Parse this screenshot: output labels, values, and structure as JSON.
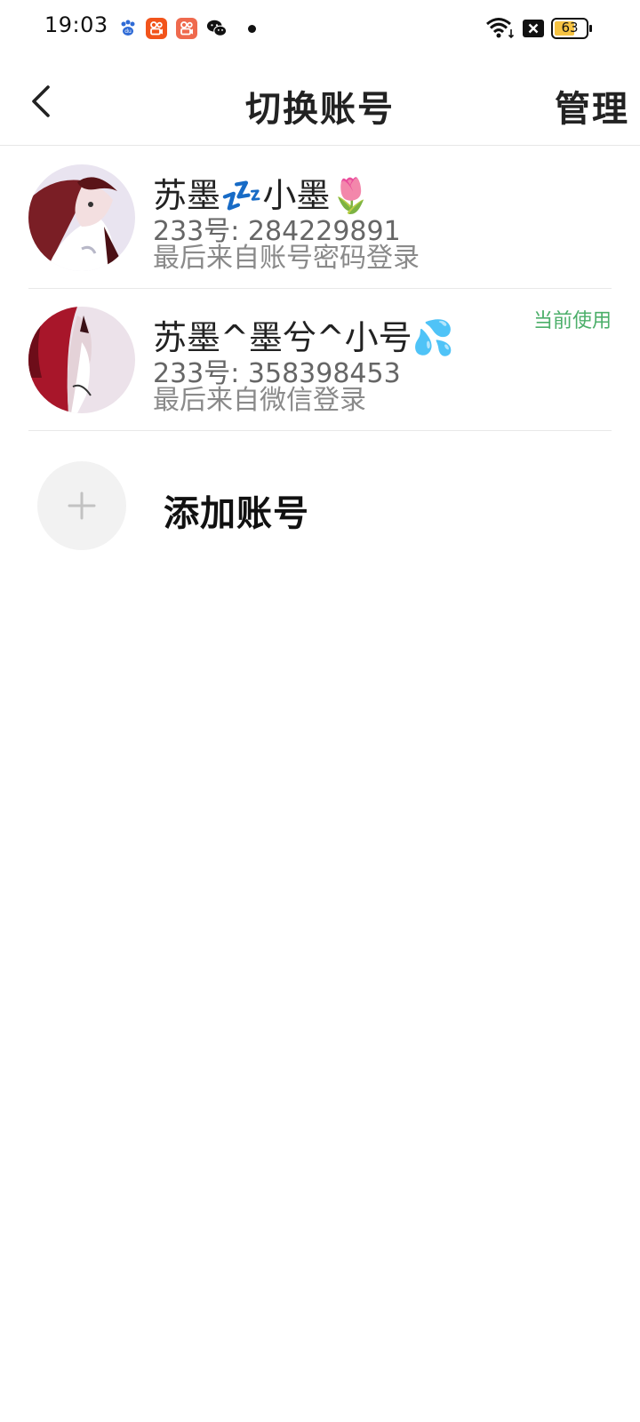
{
  "status_bar": {
    "time": "19:03",
    "battery": "63",
    "notification_icons": [
      "baidu-icon",
      "kuaishou-icon",
      "kuaishou-icon",
      "wechat-icon",
      "more-dot-icon"
    ]
  },
  "header": {
    "title": "切换账号",
    "manage_label": "管理"
  },
  "accounts": [
    {
      "name": "苏墨💤小墨🌷",
      "id_line": "233号: 284229891",
      "login_line": "最后来自账号密码登录",
      "current_label": ""
    },
    {
      "name": "苏墨^墨兮^小号💦",
      "id_line": "233号: 358398453",
      "login_line": "最后来自微信登录",
      "current_label": "当前使用"
    }
  ],
  "add_account": {
    "label": "添加账号"
  },
  "colors": {
    "accent_green": "#4caf6a",
    "text_primary": "#222222",
    "text_secondary": "#8a8a8a"
  }
}
